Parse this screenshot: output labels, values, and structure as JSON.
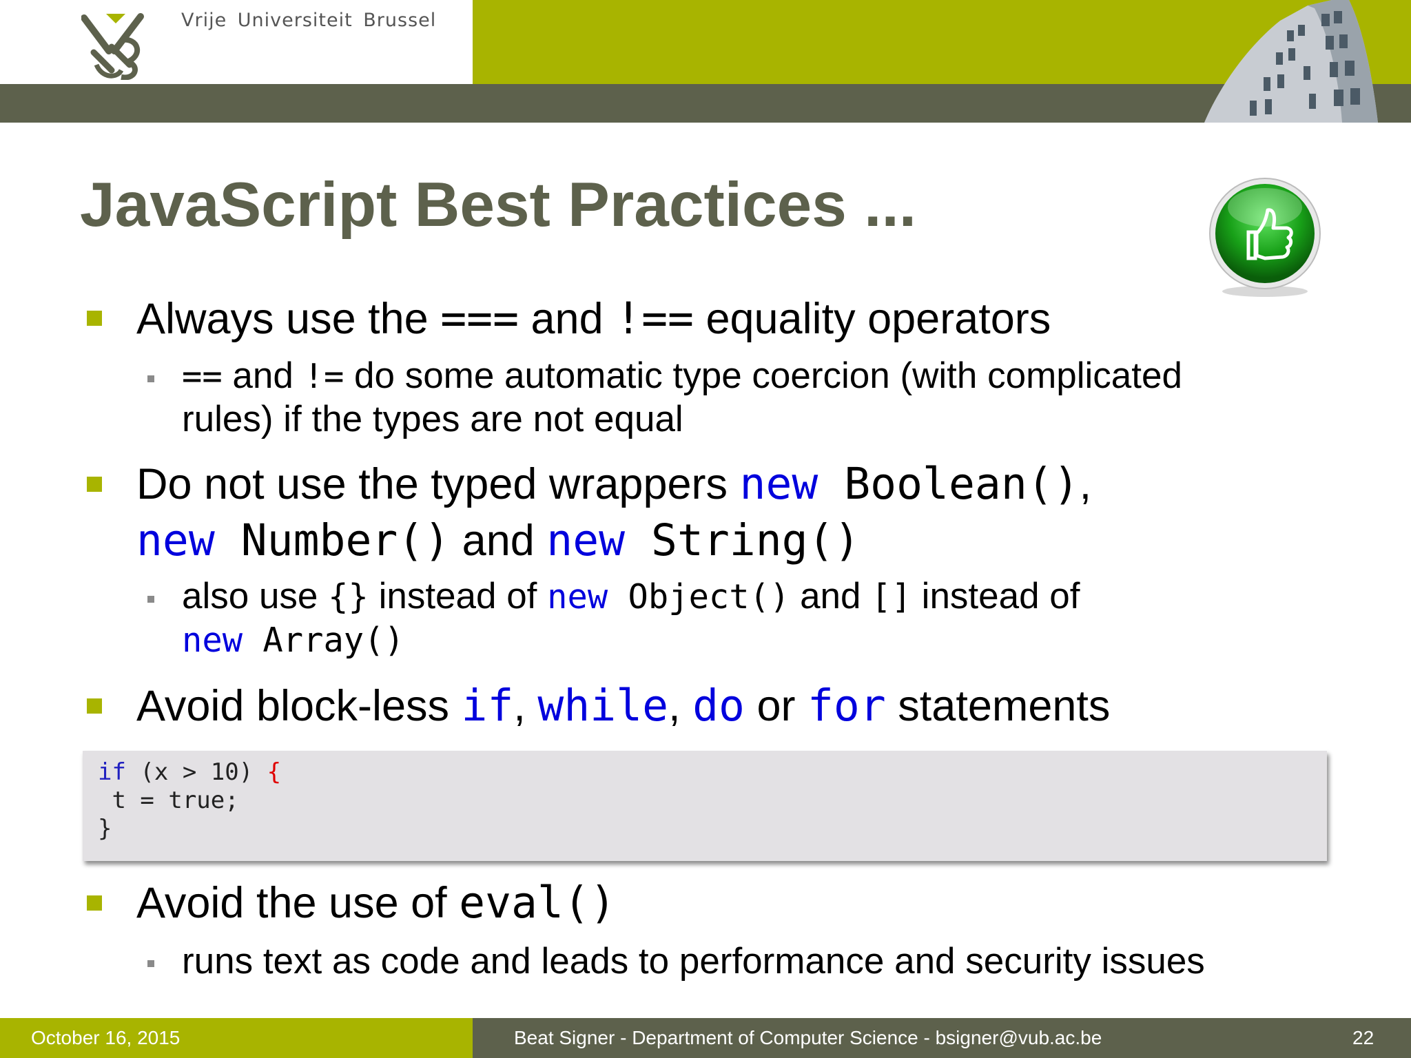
{
  "header": {
    "university": "Vrije Universiteit Brussel",
    "logo_icon": "vub-logo-icon",
    "building_icon": "building-photo-icon",
    "colors": {
      "green": "#a8b400",
      "olive": "#5d614c"
    }
  },
  "slide": {
    "title": "JavaScript Best Practices ...",
    "title_icon": "thumbs-up-icon",
    "bullets": [
      {
        "t1": "Always use the ",
        "code1": "===",
        "t2": " and ",
        "code2": "!==",
        "t3": " equality operators",
        "sub": {
          "code1": "==",
          "t1": " and ",
          "code2": "!=",
          "t2": " do some automatic type coercion (with complicated",
          "t3": "rules) if the types are not equal"
        }
      },
      {
        "t1": "Do not use the typed wrappers ",
        "kw1": "new",
        "c1": " Boolean()",
        "t2": ",",
        "kw2": "new",
        "c2": " Number()",
        "t3": " and ",
        "kw3": "new",
        "c3": " String()",
        "sub": {
          "t1": "also use ",
          "c1": "{}",
          "t2": " instead of ",
          "kw1": "new",
          "c2": " Object()",
          "t3": " and ",
          "c3": "[]",
          "t4": " instead of",
          "kw2": "new",
          "c4": " Array()"
        }
      },
      {
        "t1": "Avoid block-less ",
        "kw1": "if",
        "t2": ", ",
        "kw2": "while",
        "t3": ", ",
        "kw3": "do",
        "t4": " or ",
        "kw4": "for",
        "t5": " statements"
      },
      {
        "t1": "Avoid the use of ",
        "c1": "eval()",
        "sub": {
          "t1": "runs text as code and leads to performance and security issues"
        }
      }
    ],
    "code": {
      "line1": {
        "kw": "if",
        "mid": " (x > 10) ",
        "brace": "{"
      },
      "line2": " t = true;",
      "line3": "}"
    }
  },
  "footer": {
    "date": "October 16, 2015",
    "author": "Beat Signer - Department of Computer Science - bsigner@vub.ac.be",
    "page": "22"
  }
}
